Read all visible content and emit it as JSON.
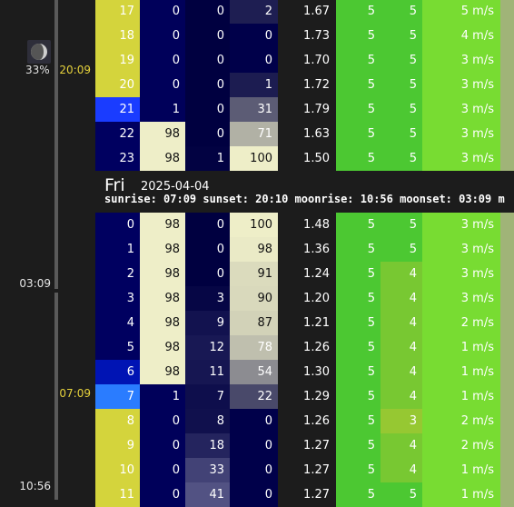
{
  "timeline": {
    "labels": [
      {
        "text": "20:09",
        "color": "#e6d23c"
      },
      {
        "text": "03:09",
        "color": "#e8e8e8"
      },
      {
        "text": "07:09",
        "color": "#e6d23c"
      },
      {
        "text": "10:56",
        "color": "#e8e8e8"
      }
    ],
    "moon_percent": "33%",
    "moon_icon": "moon-phase-icon"
  },
  "day_header": {
    "day": "Fri",
    "date": "2025-04-04",
    "astro": "sunrise: 07:09 sunset: 20:10 moonrise: 10:56 moonset: 03:09 m"
  },
  "rows_before": [
    {
      "hour": "17",
      "c1": "0",
      "c2": "0",
      "c3": "2",
      "temp": "1.67",
      "a": "5",
      "b": "5",
      "wind": "5 m/s"
    },
    {
      "hour": "18",
      "c1": "0",
      "c2": "0",
      "c3": "0",
      "temp": "1.73",
      "a": "5",
      "b": "5",
      "wind": "4 m/s"
    },
    {
      "hour": "19",
      "c1": "0",
      "c2": "0",
      "c3": "0",
      "temp": "1.70",
      "a": "5",
      "b": "5",
      "wind": "3 m/s"
    },
    {
      "hour": "20",
      "c1": "0",
      "c2": "0",
      "c3": "1",
      "temp": "1.72",
      "a": "5",
      "b": "5",
      "wind": "3 m/s"
    },
    {
      "hour": "21",
      "c1": "1",
      "c2": "0",
      "c3": "31",
      "temp": "1.79",
      "a": "5",
      "b": "5",
      "wind": "3 m/s"
    },
    {
      "hour": "22",
      "c1": "98",
      "c2": "0",
      "c3": "71",
      "temp": "1.63",
      "a": "5",
      "b": "5",
      "wind": "3 m/s"
    },
    {
      "hour": "23",
      "c1": "98",
      "c2": "1",
      "c3": "100",
      "temp": "1.50",
      "a": "5",
      "b": "5",
      "wind": "3 m/s"
    }
  ],
  "rows_after": [
    {
      "hour": "0",
      "c1": "98",
      "c2": "0",
      "c3": "100",
      "temp": "1.48",
      "a": "5",
      "b": "5",
      "wind": "3 m/s"
    },
    {
      "hour": "1",
      "c1": "98",
      "c2": "0",
      "c3": "98",
      "temp": "1.36",
      "a": "5",
      "b": "5",
      "wind": "3 m/s"
    },
    {
      "hour": "2",
      "c1": "98",
      "c2": "0",
      "c3": "91",
      "temp": "1.24",
      "a": "5",
      "b": "4",
      "wind": "3 m/s"
    },
    {
      "hour": "3",
      "c1": "98",
      "c2": "3",
      "c3": "90",
      "temp": "1.20",
      "a": "5",
      "b": "4",
      "wind": "3 m/s"
    },
    {
      "hour": "4",
      "c1": "98",
      "c2": "9",
      "c3": "87",
      "temp": "1.21",
      "a": "5",
      "b": "4",
      "wind": "2 m/s"
    },
    {
      "hour": "5",
      "c1": "98",
      "c2": "12",
      "c3": "78",
      "temp": "1.26",
      "a": "5",
      "b": "4",
      "wind": "1 m/s"
    },
    {
      "hour": "6",
      "c1": "98",
      "c2": "11",
      "c3": "54",
      "temp": "1.30",
      "a": "5",
      "b": "4",
      "wind": "1 m/s"
    },
    {
      "hour": "7",
      "c1": "1",
      "c2": "7",
      "c3": "22",
      "temp": "1.29",
      "a": "5",
      "b": "4",
      "wind": "1 m/s"
    },
    {
      "hour": "8",
      "c1": "0",
      "c2": "8",
      "c3": "0",
      "temp": "1.26",
      "a": "5",
      "b": "3",
      "wind": "2 m/s"
    },
    {
      "hour": "9",
      "c1": "0",
      "c2": "18",
      "c3": "0",
      "temp": "1.27",
      "a": "5",
      "b": "4",
      "wind": "2 m/s"
    },
    {
      "hour": "10",
      "c1": "0",
      "c2": "33",
      "c3": "0",
      "temp": "1.27",
      "a": "5",
      "b": "4",
      "wind": "1 m/s"
    },
    {
      "hour": "11",
      "c1": "0",
      "c2": "41",
      "c3": "0",
      "temp": "1.27",
      "a": "5",
      "b": "5",
      "wind": "1 m/s"
    }
  ],
  "colors": {
    "background": "#1c1c1c",
    "hour_day": "#d4d43c",
    "hour_night": "#000060",
    "hour_twilight_evening": "#1a3cff",
    "hour_twilight_morning": "#2a7cff",
    "timeline_yellow": "#e6d23c",
    "navy": "#00005a",
    "cream": "#eeeec8",
    "green_5": "#4cc832",
    "green_4": "#78c832",
    "green_3": "#96c832",
    "wind_green": "#78dc32",
    "edge_olive": "#a0b478"
  }
}
